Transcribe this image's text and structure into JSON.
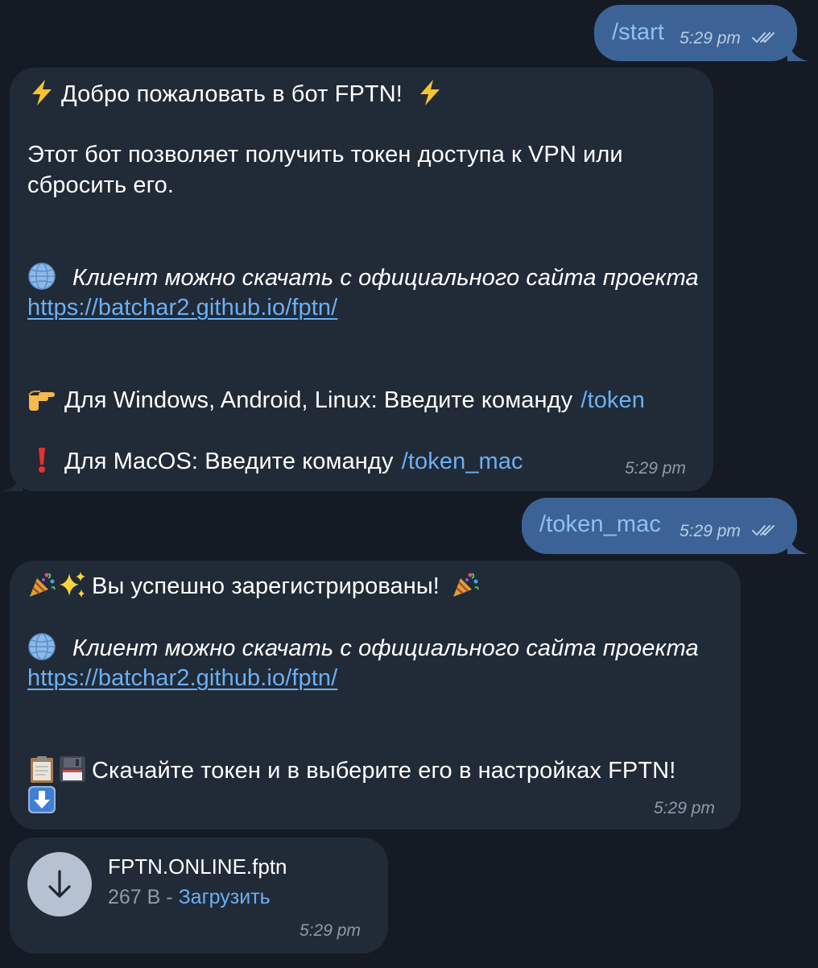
{
  "messages": {
    "start": {
      "text": "/start",
      "time": "5:29 pm"
    },
    "welcome": {
      "title": "Добро пожаловать в бот FPTN!",
      "desc_line1": "Этот бот позволяет получить токен доступа к VPN или",
      "desc_line2": "сбросить его.",
      "download_text": "Клиент можно скачать с официального сайта проекта",
      "download_link": "https://batchar2.github.io/fptn/",
      "windows_text": "Для Windows, Android, Linux:  Введите команду",
      "windows_cmd": "/token",
      "mac_text": "Для MacOS: Введите команду",
      "mac_cmd": "/token_mac",
      "time": "5:29 pm"
    },
    "token_mac": {
      "text": "/token_mac",
      "time": "5:29 pm"
    },
    "registered": {
      "title": "Вы успешно зарегистрированы!",
      "download_text": "Клиент можно скачать с официального сайта проекта",
      "download_link": "https://batchar2.github.io/fptn/",
      "instruction": "Скачайте токен и в выберите его в настройках  FPTN!",
      "time": "5:29 pm"
    },
    "file": {
      "name": "FPTN.ONLINE.fptn",
      "size": "267 B",
      "separator": " - ",
      "action": "Загрузить",
      "time": "5:29 pm"
    }
  },
  "icons": {
    "lightning": "high-voltage-emoji",
    "globe": "globe-emoji",
    "pointing": "pointing-right-emoji",
    "exclamation": "red-exclamation-emoji",
    "party": "party-popper-emoji",
    "sparkles": "sparkles-emoji",
    "clipboard": "clipboard-emoji",
    "floppy": "floppy-disk-emoji",
    "down_arrow": "down-arrow-emoji",
    "ticks": "double-check-icon",
    "download": "download-arrow-icon"
  },
  "colors": {
    "background": "#151b25",
    "incoming_bubble": "#212a37",
    "outgoing_bubble": "#3d6396",
    "link": "#6bb0f2",
    "meta": "#8f99a7"
  }
}
